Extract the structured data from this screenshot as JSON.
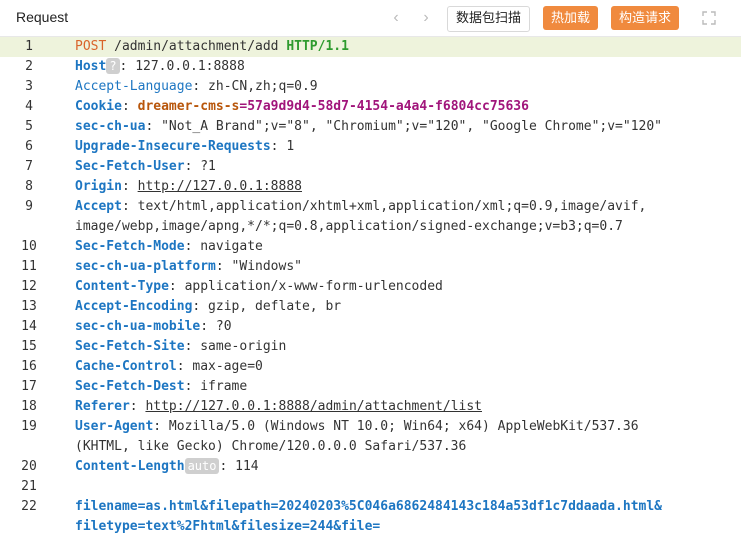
{
  "header": {
    "title": "Request",
    "scan_button": "数据包扫描",
    "hot_load_button": "热加载",
    "build_request_button": "构造请求",
    "prev_icon": "chevron-left-icon",
    "next_icon": "chevron-right-icon",
    "expand_icon": "expand-icon"
  },
  "colors": {
    "accent_orange": "#f08a3e",
    "header_key_blue": "#1d76c2",
    "active_line_bg": "#eef3dc"
  },
  "request": {
    "line1": {
      "n": "1",
      "method": "POST",
      "path": " /admin/attachment/add ",
      "version": "HTTP/1.1"
    },
    "line2": {
      "n": "2",
      "key": "Host",
      "badge": "?",
      "value": ": 127.0.0.1:8888"
    },
    "line3": {
      "n": "3",
      "key": "Accept-Language",
      "value": ": zh-CN,zh;q=0.9"
    },
    "line4": {
      "n": "4",
      "key": "Cookie",
      "sep": ": ",
      "ckey": "dreamer-cms-s",
      "cval": "=57a9d9d4-58d7-4154-a4a4-f6804cc75636"
    },
    "line5": {
      "n": "5",
      "key": "sec-ch-ua",
      "value": ": \"Not_A Brand\";v=\"8\", \"Chromium\";v=\"120\", \"Google Chrome\";v=\"120\""
    },
    "line6": {
      "n": "6",
      "key": "Upgrade-Insecure-Requests",
      "value": ": 1"
    },
    "line7": {
      "n": "7",
      "key": "Sec-Fetch-User",
      "value": ": ?1"
    },
    "line8": {
      "n": "8",
      "key": "Origin",
      "sep": ": ",
      "url": "http://127.0.0.1:8888"
    },
    "line9": {
      "n": "9",
      "key": "Accept",
      "value": ": text/html,application/xhtml+xml,application/xml;q=0.9,image/avif,",
      "cont": "image/webp,image/apng,*/*;q=0.8,application/signed-exchange;v=b3;q=0.7"
    },
    "line10": {
      "n": "10",
      "key": "Sec-Fetch-Mode",
      "value": ": navigate"
    },
    "line11": {
      "n": "11",
      "key": "sec-ch-ua-platform",
      "value": ": \"Windows\""
    },
    "line12": {
      "n": "12",
      "key": "Content-Type",
      "value": ": application/x-www-form-urlencoded"
    },
    "line13": {
      "n": "13",
      "key": "Accept-Encoding",
      "value": ": gzip, deflate, br"
    },
    "line14": {
      "n": "14",
      "key": "sec-ch-ua-mobile",
      "value": ": ?0"
    },
    "line15": {
      "n": "15",
      "key": "Sec-Fetch-Site",
      "value": ": same-origin"
    },
    "line16": {
      "n": "16",
      "key": "Cache-Control",
      "value": ": max-age=0"
    },
    "line17": {
      "n": "17",
      "key": "Sec-Fetch-Dest",
      "value": ": iframe"
    },
    "line18": {
      "n": "18",
      "key": "Referer",
      "sep": ": ",
      "url": "http://127.0.0.1:8888/admin/attachment/list"
    },
    "line19": {
      "n": "19",
      "key": "User-Agent",
      "value": ": Mozilla/5.0 (Windows NT 10.0; Win64; x64) AppleWebKit/537.36",
      "cont": "(KHTML, like Gecko) Chrome/120.0.0.0 Safari/537.36"
    },
    "line20": {
      "n": "20",
      "key": "Content-Length",
      "badge": "auto",
      "value": ": 114"
    },
    "line21": {
      "n": "21"
    },
    "line22": {
      "n": "22",
      "body": "filename=as.html&filepath=20240203%5C046a6862484143c184a53df1c7ddaada.html&",
      "body_cont": "filetype=text%2Fhtml&filesize=244&file="
    }
  }
}
